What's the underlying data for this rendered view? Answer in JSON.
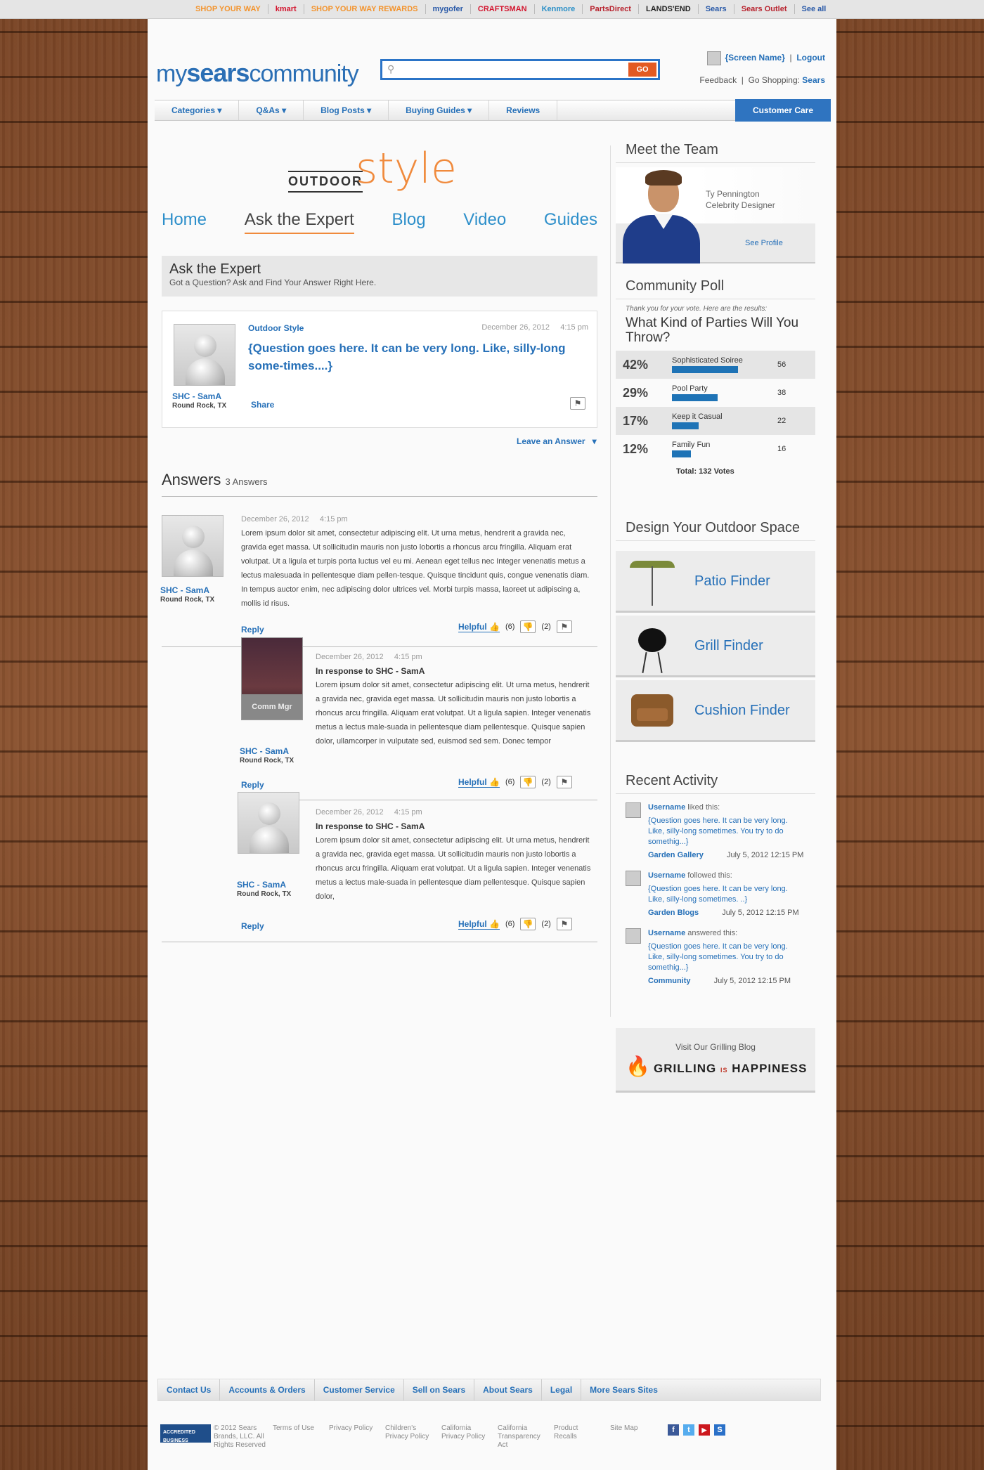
{
  "topbar": {
    "brands": [
      {
        "label": "SHOP YOUR WAY",
        "color": "#f3942e"
      },
      {
        "label": "kmart",
        "color": "#d3162f"
      },
      {
        "label": "SHOP YOUR WAY REWARDS",
        "color": "#f3942e"
      },
      {
        "label": "mygofer",
        "color": "#2a5aa8"
      },
      {
        "label": "CRAFTSMAN",
        "color": "#d3162f"
      },
      {
        "label": "Kenmore",
        "color": "#2a8fc7"
      },
      {
        "label": "PartsDirect",
        "color": "#b8232e"
      },
      {
        "label": "LANDS'END",
        "color": "#222"
      },
      {
        "label": "Sears",
        "color": "#2a5aa8"
      },
      {
        "label": "Sears Outlet",
        "color": "#b8232e"
      },
      {
        "label": "See all",
        "color": "#2a5aa8"
      }
    ]
  },
  "header": {
    "logo_pre": "my",
    "logo_mid": "sears",
    "logo_post": "community",
    "go": "GO",
    "screen_name": "{Screen Name}",
    "logout": "Logout",
    "feedback": "Feedback",
    "go_shopping": "Go Shopping:",
    "sears": "Sears"
  },
  "nav": {
    "items": [
      "Categories",
      "Q&As",
      "Blog Posts",
      "Buying Guides",
      "Reviews"
    ],
    "customer_care": "Customer Care"
  },
  "section": {
    "outdoor": "OUTDOOR",
    "style": "style",
    "tabs": [
      "Home",
      "Ask the Expert",
      "Blog",
      "Video",
      "Guides"
    ]
  },
  "ate": {
    "title": "Ask the Expert",
    "subtitle": "Got a Question? Ask and Find Your Answer Right Here."
  },
  "question": {
    "category": "Outdoor Style",
    "date": "December 26, 2012",
    "time": "4:15 pm",
    "text": "{Question goes here. It can be very long. Like, silly-long some-times....}",
    "user": "SHC - SamA",
    "loc": "Round Rock, TX",
    "share": "Share",
    "leave": "Leave an Answer"
  },
  "answers": {
    "title": "Answers",
    "count": "3 Answers",
    "items": [
      {
        "date": "December 26, 2012",
        "time": "4:15 pm",
        "user": "SHC - SamA",
        "loc": "Round Rock, TX",
        "resp": "",
        "body": "Lorem ipsum dolor sit amet, consectetur adipiscing elit. Ut urna metus, hendrerit a gravida nec, gravida eget massa. Ut sollicitudin mauris non justo lobortis a rhoncus arcu fringilla. Aliquam erat volutpat. Ut a ligula et turpis porta luctus vel eu mi. Aenean eget tellus nec Integer venenatis metus a lectus malesuada in pellentesque diam pellen-tesque. Quisque tincidunt quis, congue venenatis diam. In tempus auctor enim, nec adipiscing dolor ultrices vel. Morbi turpis massa, laoreet ut adipiscing a, mollis id risus.",
        "reply": "Reply",
        "helpful": "Helpful",
        "up": "(6)",
        "down": "(2)"
      },
      {
        "date": "December 26, 2012",
        "time": "4:15 pm",
        "user": "SHC - SamA",
        "loc": "Round Rock, TX",
        "resp": "In response to SHC - SamA",
        "badge": "Comm Mgr",
        "body": "Lorem ipsum dolor sit amet, consectetur adipiscing elit. Ut urna metus, hendrerit a gravida nec, gravida eget massa. Ut sollicitudin mauris non justo lobortis a rhoncus arcu fringilla. Aliquam erat volutpat. Ut a ligula sapien. Integer venenatis metus a lectus male-suada in pellentesque diam pellentesque. Quisque sapien dolor, ullamcorper in vulputate sed, euismod sed sem. Donec tempor",
        "reply": "Reply",
        "helpful": "Helpful",
        "up": "(6)",
        "down": "(2)"
      },
      {
        "date": "December 26, 2012",
        "time": "4:15 pm",
        "user": "SHC - SamA",
        "loc": "Round Rock, TX",
        "resp": "In response to SHC - SamA",
        "body": "Lorem ipsum dolor sit amet, consectetur adipiscing elit. Ut urna metus, hendrerit a gravida nec, gravida eget massa. Ut sollicitudin mauris non justo lobortis a rhoncus arcu fringilla. Aliquam erat volutpat. Ut a ligula sapien. Integer venenatis metus a lectus male-suada in pellentesque diam pellentesque. Quisque sapien dolor,",
        "reply": "Reply",
        "helpful": "Helpful",
        "up": "(6)",
        "down": "(2)"
      }
    ]
  },
  "team": {
    "title": "Meet the Team",
    "name": "Ty Pennington",
    "role": "Celebrity Designer",
    "profile": "See Profile"
  },
  "poll": {
    "title": "Community Poll",
    "thanks": "Thank you for your vote. Here are the results:",
    "question": "What Kind of Parties Will You Throw?",
    "rows": [
      {
        "pct": "42%",
        "label": "Sophisticated Soiree",
        "count": "56",
        "frac": 0.42
      },
      {
        "pct": "29%",
        "label": "Pool Party",
        "count": "38",
        "frac": 0.29
      },
      {
        "pct": "17%",
        "label": "Keep it Casual",
        "count": "22",
        "frac": 0.17
      },
      {
        "pct": "12%",
        "label": "Family Fun",
        "count": "16",
        "frac": 0.12
      }
    ],
    "total": "Total: 132 Votes"
  },
  "design": {
    "title": "Design Your Outdoor Space",
    "finders": [
      "Patio Finder",
      "Grill Finder",
      "Cushion Finder"
    ]
  },
  "activity": {
    "title": "Recent Activity",
    "items": [
      {
        "user": "Username",
        "action": "liked this:",
        "text": "{Question goes here. It can be very long. Like, silly-long sometimes. You try to do somethig...}",
        "src": "Garden Gallery",
        "date": "July 5, 2012 12:15 PM"
      },
      {
        "user": "Username",
        "action": "followed this:",
        "text": "{Question goes here. It can be very long. Like, silly-long sometimes. ..}",
        "src": "Garden Blogs",
        "date": "July 5, 2012 12:15 PM"
      },
      {
        "user": "Username",
        "action": "answered this:",
        "text": "{Question goes here. It can be very long. Like, silly-long sometimes. You try to do somethig...}",
        "src": "Community",
        "date": "July 5, 2012 12:15 PM"
      }
    ]
  },
  "grill": {
    "visit": "Visit Our Grilling Blog",
    "name_a": "GRILLING",
    "name_is": "IS",
    "name_b": "HAPPINESS"
  },
  "footer": {
    "links": [
      "Contact Us",
      "Accounts & Orders",
      "Customer Service",
      "Sell on Sears",
      "About Sears",
      "Legal",
      "More Sears Sites"
    ],
    "bbb": "ACCREDITED BUSINESS",
    "copy": "© 2012 Sears Brands, LLC. All Rights Reserved",
    "small": [
      "Terms of Use",
      "Privacy Policy",
      "Children's Privacy Policy",
      "California Privacy Policy",
      "California Transparency Act",
      "Product Recalls",
      "Site Map"
    ]
  }
}
